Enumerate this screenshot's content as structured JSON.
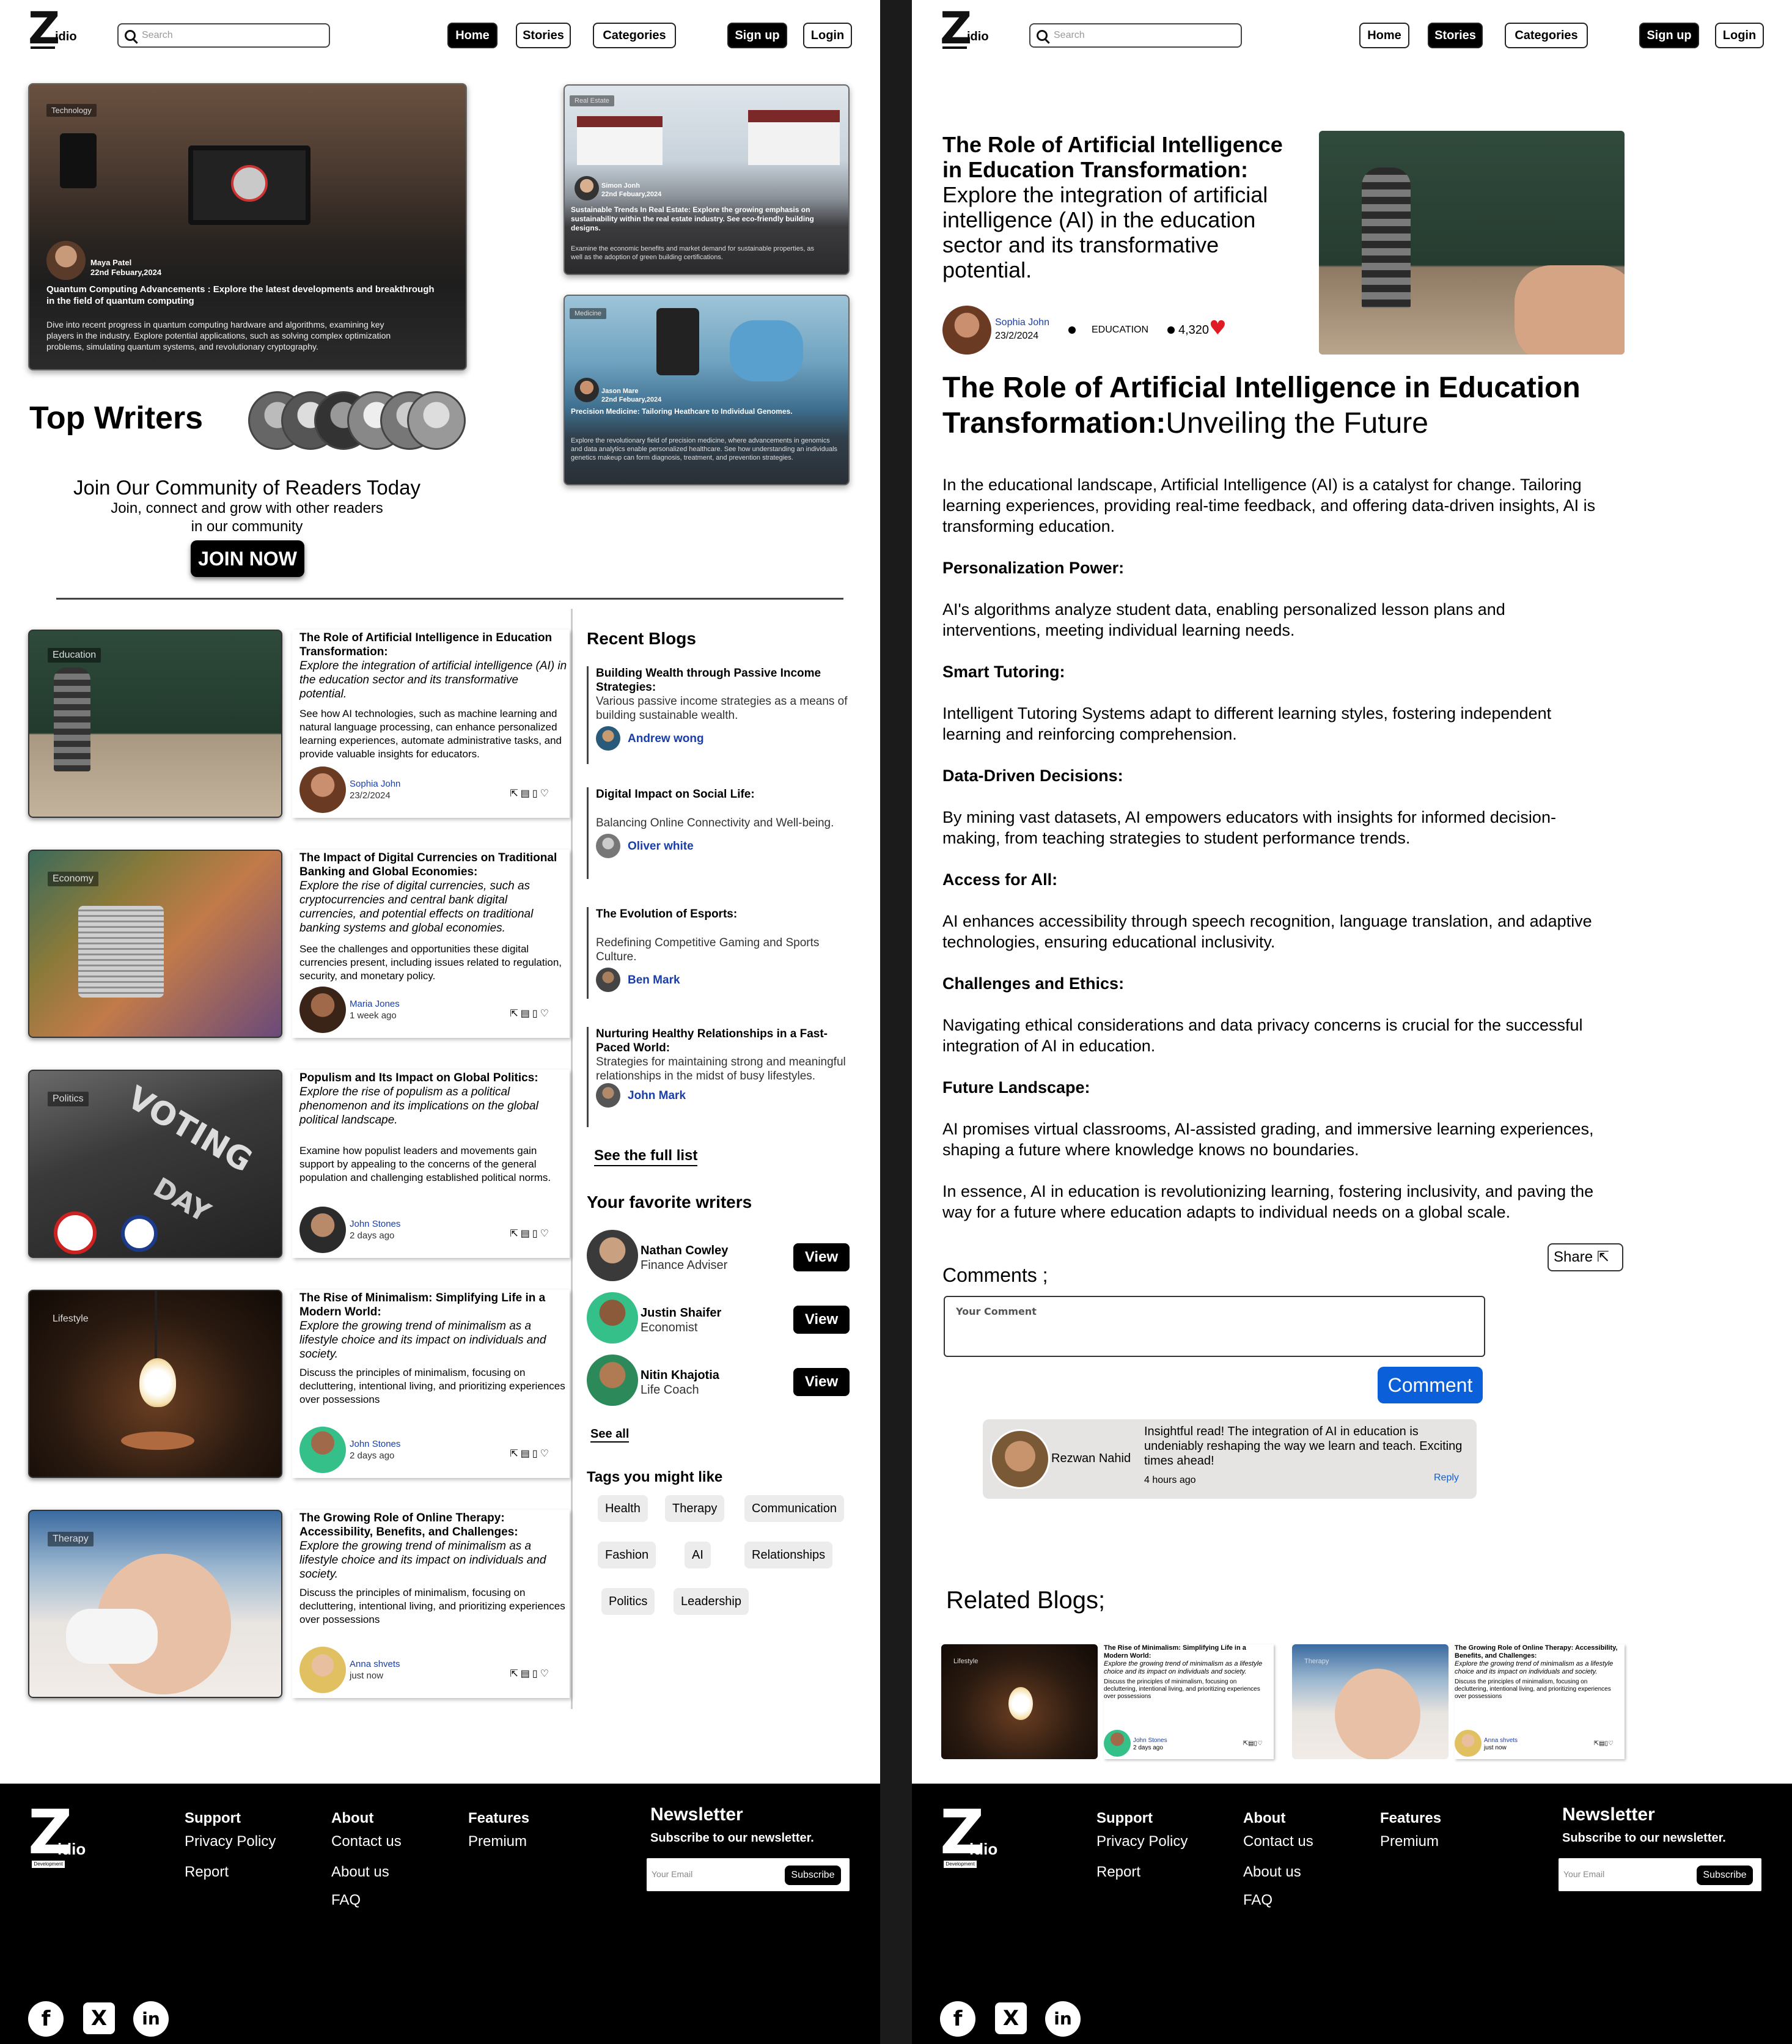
{
  "nav": {
    "search_placeholder": "Search",
    "home": "Home",
    "stories": "Stories",
    "categories": "Categories",
    "signup": "Sign up",
    "login": "Login",
    "logo_z": "Z",
    "logo_idio": "idio"
  },
  "hero": [
    {
      "tag": "Technology",
      "author": "Maya Patel",
      "date": "22nd Febuary,2024",
      "title": "Quantum Computing Advancements : Explore the latest developments and breakthrough in the field of quantum computing",
      "body": "Dive into recent progress in quantum computing hardware and algorithms, examining key players in the industry. Explore potential applications, such as solving complex optimization problems, simulating quantum systems, and revolutionary cryptography."
    },
    {
      "tag": "Real Estate",
      "author": "Simon Jonh",
      "date": "22nd Febuary,2024",
      "title": "Sustainable Trends In Real Estate: Explore the growing emphasis on sustainability within the real estate industry. See eco-friendly building designs.",
      "body": "Examine the economic benefits and market demand for sustainable properties, as well as the adoption of green building certifications."
    },
    {
      "tag": "Medicine",
      "author": "Jason Mare",
      "date": "22nd Febuary,2024",
      "title": "Precision Medicine: Tailoring Heathcare to Individual Genomes.",
      "body": "Explore the revolutionary field of precision medicine, where advancements in genomics and data analytics enable personalized healthcare. See how understanding an individuals genetics makeup can form diagnosis, treatment, and prevention strategies."
    }
  ],
  "top_writers": "Top Writers",
  "join": {
    "title": "Join Our Community of Readers Today",
    "line1": "Join, connect and grow with other readers",
    "line2": "in our community",
    "button": "JOIN NOW"
  },
  "blogs": [
    {
      "tag": "Education",
      "title": "The Role of Artificial Intelligence in Education Transformation:",
      "subtitle": " Explore the integration of  artificial intelligence (AI) in the education sector and its transformative potential.",
      "body": "See how AI technologies, such as machine learning and natural language processing, can enhance personalized learning experiences, automate administrative tasks, and provide valuable insights for educators.",
      "author": "Sophia John",
      "date": "23/2/2024"
    },
    {
      "tag": "Economy",
      "title": "The Impact of Digital Currencies on Traditional Banking and Global Economies:",
      "subtitle": "Explore the rise of digital currencies, such as cryptocurrencies and central bank digital currencies, and potential effects on traditional banking systems and global economies.",
      "body": "See the challenges and opportunities these digital currencies present, including issues related to regulation, security, and monetary policy.",
      "author": "Maria Jones",
      "date": "1 week ago"
    },
    {
      "tag": "Politics",
      "title": "Populism and Its Impact on Global Politics:",
      "subtitle": "Explore the rise of populism as a political phenomenon and its implications on the global political landscape.",
      "body": "Examine how populist leaders and movements gain support by appealing to the concerns of the general population and challenging established political norms.",
      "author": "John Stones",
      "date": "2 days ago"
    },
    {
      "tag": "Lifestyle",
      "title": "The Rise of Minimalism: Simplifying Life in a Modern World:",
      "subtitle": "Explore the growing trend of minimalism as a lifestyle choice and its impact on individuals and society.",
      "body": "Discuss the principles of minimalism, focusing on decluttering, intentional living, and prioritizing experiences over possessions",
      "author": "John Stones",
      "date": "2 days ago"
    },
    {
      "tag": "Therapy",
      "title": "The Growing Role of Online Therapy: Accessibility, Benefits, and Challenges:",
      "subtitle": "Explore the growing trend of minimalism as a lifestyle choice and its impact on individuals and society.",
      "body": "Discuss the principles of minimalism, focusing on decluttering, intentional living, and prioritizing experiences over possessions",
      "author": "Anna shvets",
      "date": "just now"
    }
  ],
  "recent": {
    "heading": "Recent Blogs",
    "items": [
      {
        "title": "Building Wealth through Passive Income Strategies:",
        "desc": "Various passive income strategies as a means of building sustainable wealth.",
        "author": "Andrew wong"
      },
      {
        "title": "Digital Impact on Social Life:",
        "desc": "Balancing Online Connectivity and Well-being.",
        "author": "Oliver white"
      },
      {
        "title": "The Evolution of Esports:",
        "desc": "Redefining Competitive Gaming and Sports Culture.",
        "author": "Ben Mark"
      },
      {
        "title": "Nurturing Healthy Relationships in a Fast-Paced World:",
        "desc": "Strategies for maintaining strong and meaningful relationships in the midst of busy lifestyles.",
        "author": "John Mark"
      }
    ],
    "see_full": "See the full list"
  },
  "fav": {
    "heading": "Your favorite writers",
    "items": [
      {
        "name": "Nathan Cowley",
        "role": "Finance Adviser",
        "btn": "View"
      },
      {
        "name": "Justin Shaifer",
        "role": "Economist",
        "btn": "View"
      },
      {
        "name": "Nitin Khajotia",
        "role": "Life Coach",
        "btn": "View"
      }
    ],
    "see_all": "See all"
  },
  "tags": {
    "heading": "Tags you might like",
    "items": [
      "Health",
      "Therapy",
      "Communication",
      "Fashion",
      "AI",
      "Relationships",
      "Politics",
      "Leadership"
    ]
  },
  "footer": {
    "support": "Support",
    "privacy": "Privacy Policy",
    "report": "Report",
    "about": "About",
    "contact": "Contact us",
    "about_us": "About us",
    "faq": "FAQ",
    "features": "Features",
    "premium": "Premium",
    "newsletter": "Newsletter",
    "sub_text": "Subscribe to our newsletter.",
    "email_ph": "Your Email",
    "subscribe": "Subscribe",
    "dev": "Development"
  },
  "article": {
    "head_bold": "The Role of Artificial Intelligence in Education Transformation:",
    "head_rest": "Explore the integration of artificial intelligence (AI) in the education sector and its transformative potential.",
    "author": "Sophia John",
    "date": "23/2/2024",
    "category": "EDUCATION",
    "likes": "4,320",
    "title_bold": "The Role of Artificial Intelligence in Education Transformation:",
    "title_rest": "Unveiling the Future",
    "intro": "In the educational landscape, Artificial Intelligence (AI) is a catalyst for change. Tailoring learning experiences, providing real-time feedback, and offering data-driven insights, AI is transforming education.",
    "sections": [
      {
        "h": "Personalization Power:",
        "p": "AI's algorithms analyze student data, enabling personalized lesson plans and interventions, meeting individual learning needs."
      },
      {
        "h": "Smart Tutoring:",
        "p": "Intelligent Tutoring Systems adapt to different learning styles, fostering independent learning and reinforcing comprehension."
      },
      {
        "h": "Data-Driven Decisions:",
        "p": "By mining vast datasets, AI empowers educators with insights for informed decision-making, from teaching strategies to student performance trends."
      },
      {
        "h": "Access for All:",
        "p": "AI enhances accessibility through speech recognition, language translation, and adaptive technologies, ensuring educational inclusivity."
      },
      {
        "h": "Challenges and Ethics:",
        "p": "Navigating ethical considerations and data privacy concerns is crucial for the successful integration of AI in education."
      },
      {
        "h": "Future Landscape:",
        "p": "AI promises virtual classrooms, AI-assisted grading, and immersive learning experiences, shaping a future where knowledge knows no boundaries."
      }
    ],
    "conclusion": "In essence, AI in education is revolutionizing learning, fostering inclusivity, and paving the way for a future where education adapts to individual needs on a global scale.",
    "share": "Share",
    "comments_label": "Comments ;",
    "comment_placeholder": "Your Comment",
    "comment_btn": "Comment",
    "comment": {
      "name": "Rezwan Nahid",
      "text": "Insightful read! The integration of AI in education is undeniably reshaping the way we learn and teach. Exciting times ahead!",
      "time": "4 hours ago",
      "reply": "Reply"
    },
    "related": "Related Blogs;"
  },
  "colors": {
    "accent_blue": "#1a3ea8",
    "comment_btn": "#0b5fd9",
    "heart": "#e01b24"
  }
}
